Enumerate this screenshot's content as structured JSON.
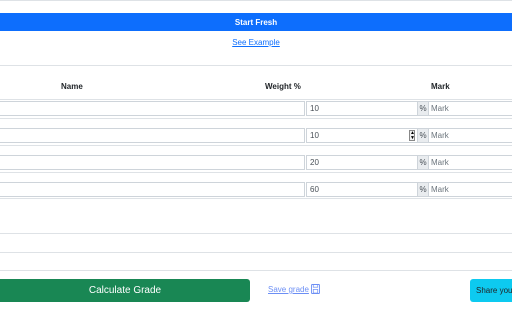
{
  "top": {
    "start_label": "Start Fresh",
    "example_label": "See Example"
  },
  "table": {
    "headers": {
      "name": "Name",
      "weight": "Weight %",
      "mark": "Mark"
    },
    "rows": [
      {
        "name": "",
        "weight": "10",
        "percent": "%",
        "mark_placeholder": "Mark"
      },
      {
        "name": "",
        "weight": "10",
        "percent": "%",
        "mark_placeholder": "Mark"
      },
      {
        "name": "",
        "weight": "20",
        "percent": "%",
        "mark_placeholder": "Mark"
      },
      {
        "name": "",
        "weight": "60",
        "percent": "%",
        "mark_placeholder": "Mark"
      }
    ]
  },
  "actions": {
    "calculate_label": "Calculate Grade",
    "save_label": "Save grade",
    "share_label": "Share your"
  },
  "colors": {
    "primary": "#0d6efd",
    "success": "#198754",
    "info": "#0dcaf0"
  }
}
